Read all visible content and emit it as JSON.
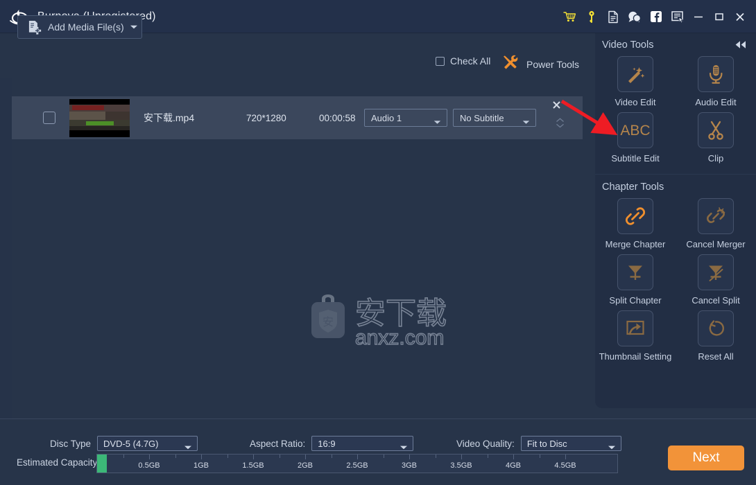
{
  "window": {
    "title": "Burnova (Unregistered)",
    "logo_icon": "burnova-flame-disc-logo",
    "titlebar_icons": [
      {
        "name": "cart-icon",
        "label": "Buy"
      },
      {
        "name": "key-icon",
        "label": "Register"
      },
      {
        "name": "document-icon",
        "label": "Help Document"
      },
      {
        "name": "chat-icon",
        "label": "Support"
      },
      {
        "name": "facebook-icon",
        "label": "Facebook"
      },
      {
        "name": "feedback-icon",
        "label": "Feedback"
      },
      {
        "name": "minimize-icon",
        "label": "Minimize"
      },
      {
        "name": "maximize-icon",
        "label": "Maximize"
      },
      {
        "name": "close-icon",
        "label": "Close"
      }
    ]
  },
  "toolbar": {
    "add_media_label": "Add Media File(s)",
    "add_media_icon": "add-file-icon",
    "check_all_label": "Check All",
    "check_all_checked": false,
    "power_tools_label": "Power Tools",
    "power_tools_icon": "wrench-screwdriver-icon"
  },
  "media_list": {
    "rows": [
      {
        "checked": false,
        "thumbnail": "video-frame-thumbnail",
        "file_name": "安下载.mp4",
        "resolution": "720*1280",
        "duration": "00:00:58",
        "audio_track": "Audio 1",
        "subtitle_track": "No Subtitle",
        "remove_icon": "close-icon",
        "expand_icon": "chevron-down-icon"
      }
    ]
  },
  "watermark": {
    "text_cn": "安下载",
    "text_domain": "anxz.com",
    "icon": "anxz-bag-shield-logo"
  },
  "right_panel": {
    "collapse_icon": "double-chevron-left-icon",
    "sections": [
      {
        "title": "Video Tools",
        "tools": [
          {
            "label": "Video Edit",
            "icon": "magic-wand-icon",
            "enabled": true
          },
          {
            "label": "Audio Edit",
            "icon": "microphone-icon",
            "enabled": true
          },
          {
            "label": "Subtitle Edit",
            "icon": "abc-text-icon",
            "enabled": true
          },
          {
            "label": "Clip",
            "icon": "scissors-icon",
            "enabled": true
          }
        ]
      },
      {
        "title": "Chapter Tools",
        "tools": [
          {
            "label": "Merge Chapter",
            "icon": "chain-link-icon",
            "enabled": true
          },
          {
            "label": "Cancel Merger",
            "icon": "broken-chain-icon",
            "enabled": false
          },
          {
            "label": "Split Chapter",
            "icon": "split-funnel-icon",
            "enabled": false
          },
          {
            "label": "Cancel Split",
            "icon": "cancel-split-icon",
            "enabled": false
          },
          {
            "label": "Thumbnail Setting",
            "icon": "thumbnail-frame-arrow-icon",
            "enabled": false
          },
          {
            "label": "Reset All",
            "icon": "reset-circular-arrow-icon",
            "enabled": false
          }
        ]
      }
    ]
  },
  "bottom_bar": {
    "disc_type_label": "Disc Type",
    "disc_type_value": "DVD-5 (4.7G)",
    "aspect_ratio_label": "Aspect Ratio:",
    "aspect_ratio_value": "16:9",
    "video_quality_label": "Video Quality:",
    "video_quality_value": "Fit to Disc",
    "capacity_label": "Estimated Capacity:",
    "capacity_ticks": [
      "0.5GB",
      "1GB",
      "1.5GB",
      "2GB",
      "2.5GB",
      "3GB",
      "3.5GB",
      "4GB",
      "4.5GB"
    ],
    "capacity_fill_percent": 1.9,
    "next_label": "Next"
  },
  "annotation": {
    "arrow_color": "#ee1c24",
    "arrow_from": "row-actions",
    "arrow_to": "video-tools-panel"
  },
  "colors": {
    "accent_orange": "#f29339",
    "tool_bronze": "#a9study",
    "panel_bg": "#222e44",
    "main_bg": "#273449",
    "titlebar_bg": "#23304a",
    "row_selected": "#3b475c",
    "capacity_green": "#3cb878"
  }
}
